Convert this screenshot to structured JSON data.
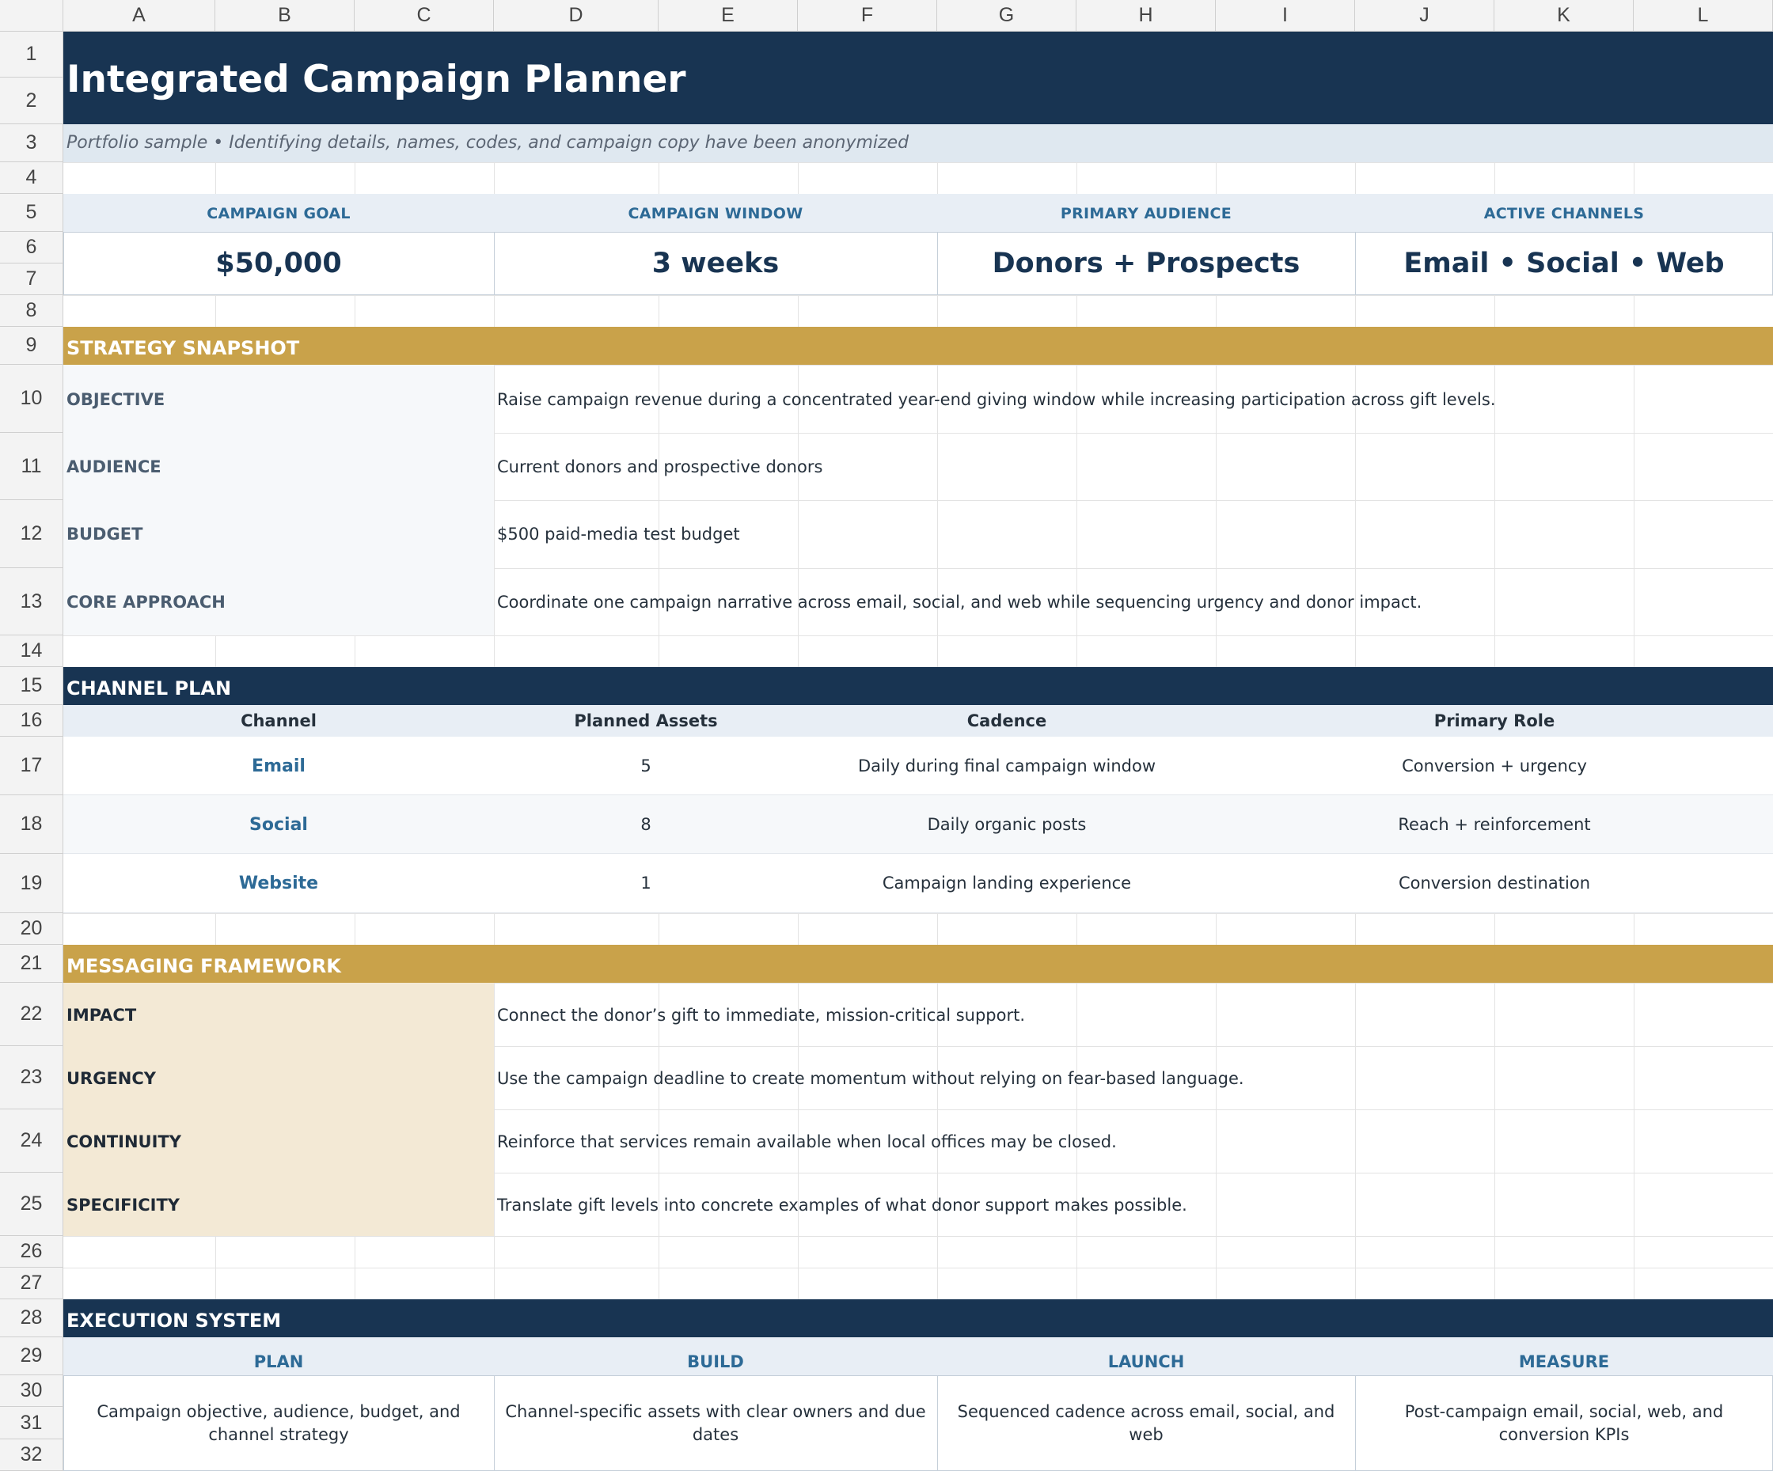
{
  "columns": [
    "A",
    "B",
    "C",
    "D",
    "E",
    "F",
    "G",
    "H",
    "I",
    "J",
    "K",
    "L"
  ],
  "rows": [
    "1",
    "2",
    "3",
    "4",
    "5",
    "6",
    "7",
    "8",
    "9",
    "10",
    "11",
    "12",
    "13",
    "14",
    "15",
    "16",
    "17",
    "18",
    "19",
    "20",
    "21",
    "22",
    "23",
    "24",
    "25",
    "26",
    "27",
    "28",
    "29",
    "30",
    "31",
    "32"
  ],
  "title": "Integrated Campaign Planner",
  "subtitle": "Portfolio sample • Identifying details, names, codes, and campaign copy have been anonymized",
  "kpis": [
    {
      "label": "CAMPAIGN GOAL",
      "value": "$50,000"
    },
    {
      "label": "CAMPAIGN WINDOW",
      "value": "3 weeks"
    },
    {
      "label": "PRIMARY AUDIENCE",
      "value": "Donors + Prospects"
    },
    {
      "label": "ACTIVE CHANNELS",
      "value": "Email • Social • Web"
    }
  ],
  "strategy": {
    "header": "STRATEGY SNAPSHOT",
    "rows": [
      {
        "label": "OBJECTIVE",
        "value": "Raise campaign revenue during a concentrated year-end giving window while increasing participation across gift levels."
      },
      {
        "label": "AUDIENCE",
        "value": "Current donors and prospective donors"
      },
      {
        "label": "BUDGET",
        "value": "$500 paid-media test budget"
      },
      {
        "label": "CORE APPROACH",
        "value": "Coordinate one campaign narrative across email, social, and web while sequencing urgency and donor impact."
      }
    ]
  },
  "channel_plan": {
    "header": "CHANNEL PLAN",
    "columns": [
      "Channel",
      "Planned Assets",
      "Cadence",
      "Primary Role"
    ],
    "rows": [
      {
        "channel": "Email",
        "assets": "5",
        "cadence": "Daily during final campaign window",
        "role": "Conversion + urgency"
      },
      {
        "channel": "Social",
        "assets": "8",
        "cadence": "Daily organic posts",
        "role": "Reach + reinforcement"
      },
      {
        "channel": "Website",
        "assets": "1",
        "cadence": "Campaign landing experience",
        "role": "Conversion destination"
      }
    ]
  },
  "messaging": {
    "header": "MESSAGING FRAMEWORK",
    "rows": [
      {
        "label": "IMPACT",
        "value": "Connect the donor’s gift to immediate, mission-critical support."
      },
      {
        "label": "URGENCY",
        "value": "Use the campaign deadline to create momentum without relying on fear-based language."
      },
      {
        "label": "CONTINUITY",
        "value": "Reinforce that services remain available when local offices may be closed."
      },
      {
        "label": "SPECIFICITY",
        "value": "Translate gift levels into concrete examples of what donor support makes possible."
      }
    ]
  },
  "execution": {
    "header": "EXECUTION SYSTEM",
    "stages": [
      {
        "label": "PLAN",
        "text": "Campaign objective, audience, budget, and channel strategy"
      },
      {
        "label": "BUILD",
        "text": "Channel-specific assets with clear owners and due dates"
      },
      {
        "label": "LAUNCH",
        "text": "Sequenced cadence across email, social, and web"
      },
      {
        "label": "MEASURE",
        "text": "Post-campaign email, social, web, and conversion KPIs"
      }
    ]
  },
  "colors": {
    "navy": "#183452",
    "gold": "#c9a24a",
    "accent_blue": "#2d6a96",
    "pale_blue": "#e8eef5",
    "cream": "#f3e9d5"
  }
}
